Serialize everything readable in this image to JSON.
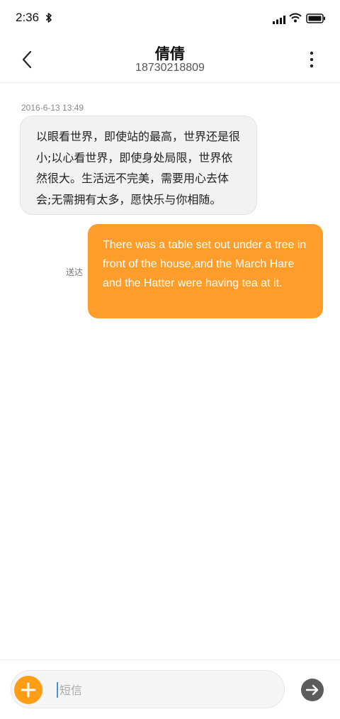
{
  "status_bar": {
    "time": "2:36",
    "icons": [
      "bluetooth-icon",
      "signal-icon",
      "wifi-icon",
      "battery-icon"
    ]
  },
  "header": {
    "contact_name": "倩倩",
    "contact_number": "18730218809",
    "icons": [
      "back-arrow-icon",
      "more-vertical-icon"
    ]
  },
  "conversation": {
    "timestamp": "2016-6-13 13:49",
    "incoming_message": "以眼看世界，即使站的最高，世界还是很小;以心看世界，即使身处局限，世界依然很大。生活远不完美，需要用心去体会;无需拥有太多，愿快乐与你相随。",
    "outgoing_message": "There was a table set out under a tree in front of the house,and the March Hare and the Hatter were having tea at it.",
    "outgoing_status": "送达"
  },
  "composer": {
    "placeholder": "短信",
    "value": "",
    "icons": [
      "plus-icon",
      "send-arrow-icon"
    ]
  },
  "colors": {
    "accent": "#ff9d2b",
    "incoming_bubble": "#f2f2f2",
    "send_button": "#5c5c5c"
  }
}
